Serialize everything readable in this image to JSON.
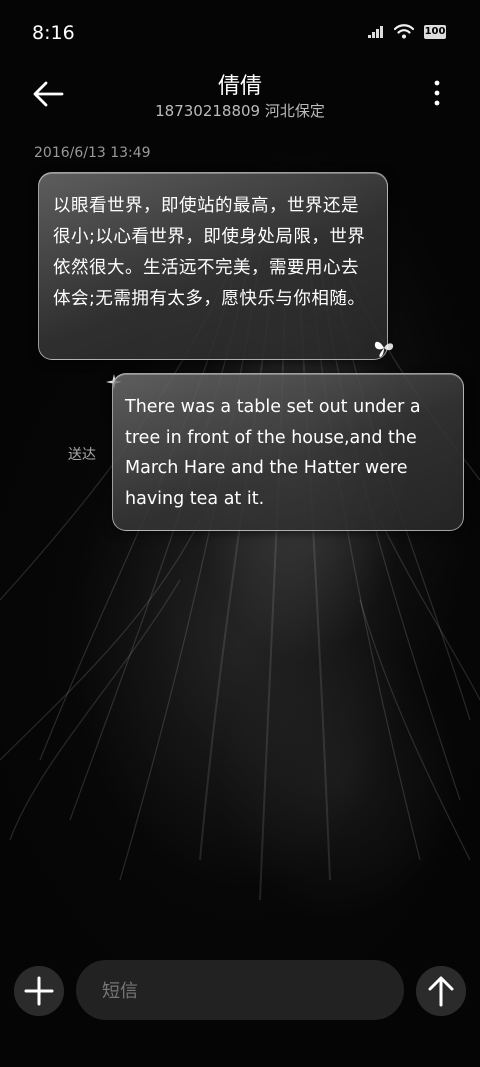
{
  "status_bar": {
    "time": "8:16",
    "battery": "100"
  },
  "header": {
    "contact_name": "倩倩",
    "contact_subtitle": "18730218809 河北保定"
  },
  "conversation": {
    "timestamp": "2016/6/13 13:49",
    "incoming_message": "以眼看世界，即使站的最高，世界还是很小;以心看世界，即使身处局限，世界依然很大。生活远不完美，需要用心去体会;无需拥有太多，愿快乐与你相随。",
    "outgoing_message": "There was a table set out under a tree in front of the house,and the March Hare and the Hatter were having tea at it.",
    "delivery_status": "送达"
  },
  "composer": {
    "placeholder": "短信"
  },
  "icons": {
    "back": "arrow-left-icon",
    "more": "more-vertical-icon",
    "add": "plus-icon",
    "send": "arrow-up-icon",
    "signal": "signal-icon",
    "wifi": "wifi-icon",
    "battery": "battery-icon",
    "butterfly": "butterfly-icon",
    "sparkle": "sparkle-icon"
  }
}
